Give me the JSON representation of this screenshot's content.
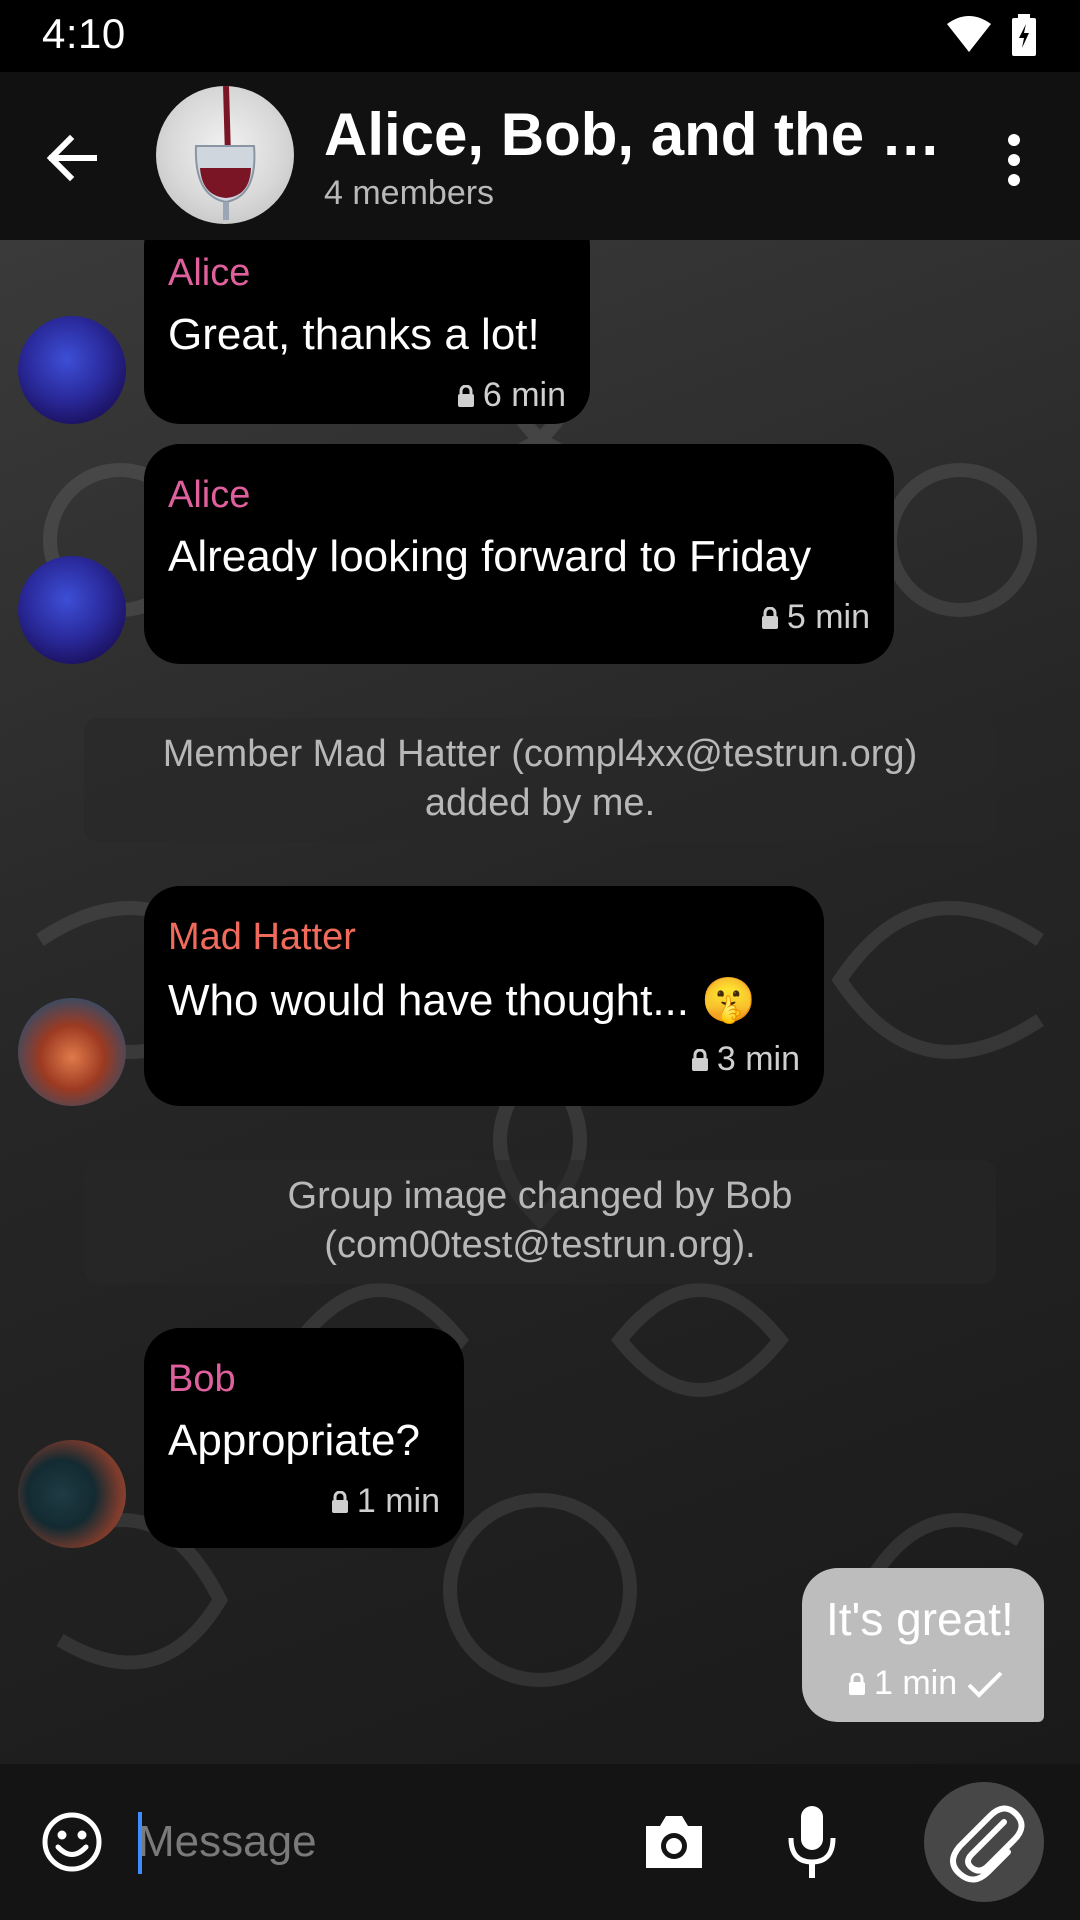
{
  "status_bar": {
    "time": "4:10"
  },
  "header": {
    "title": "Alice, Bob, and the M…",
    "subtitle": "4 members"
  },
  "messages": [
    {
      "sender": "Alice",
      "text": "Great, thanks a lot!",
      "time": "6 min"
    },
    {
      "sender": "Alice",
      "text": "Already looking forward to Friday",
      "time": "5 min"
    },
    {
      "system_line1": "Member Mad Hatter (compl4xx@testrun.org)",
      "system_line2": "added by me."
    },
    {
      "sender": "Mad Hatter",
      "text": "Who would have thought... 🤫",
      "time": "3 min"
    },
    {
      "system_line1": "Group image changed by Bob",
      "system_line2": "(com00test@testrun.org)."
    },
    {
      "sender": "Bob",
      "text": "Appropriate?",
      "time": "1 min"
    }
  ],
  "outgoing": {
    "text": "It's great!",
    "time": "1 min"
  },
  "input": {
    "placeholder": "Message"
  },
  "colors": {
    "alice": "#e0609e",
    "mad_hatter": "#f06b5b",
    "bob": "#e0609e",
    "caret": "#3f8cff"
  },
  "icons": [
    "back-arrow-icon",
    "more-vert-icon",
    "wifi-icon",
    "battery-icon",
    "lock-icon",
    "check-icon",
    "emoji-icon",
    "camera-icon",
    "microphone-icon",
    "paperclip-icon"
  ]
}
